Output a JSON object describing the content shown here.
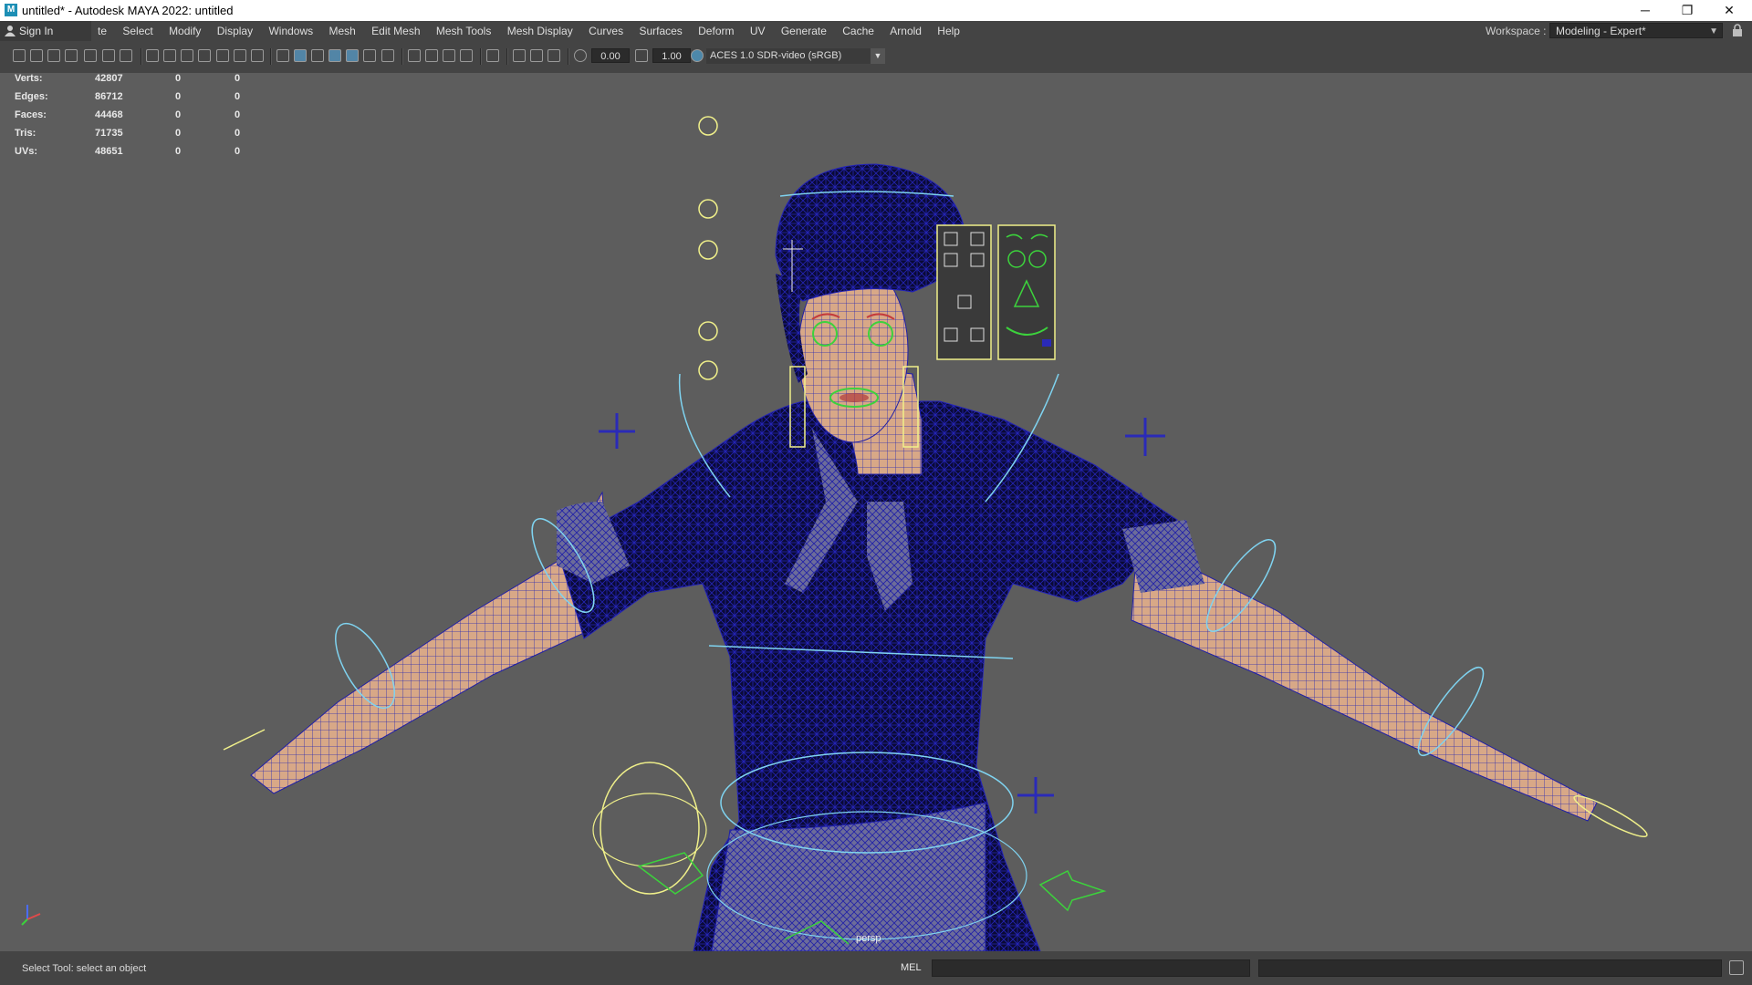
{
  "window": {
    "title": "untitled* - Autodesk MAYA 2022: untitled",
    "icon": "maya-logo-icon",
    "controls": {
      "minimize": "─",
      "restore": "❐",
      "close": "✕"
    }
  },
  "menubar": {
    "sign_in": "Sign In",
    "items": [
      "te",
      "Select",
      "Modify",
      "Display",
      "Windows",
      "Mesh",
      "Edit Mesh",
      "Mesh Tools",
      "Mesh Display",
      "Curves",
      "Surfaces",
      "Deform",
      "UV",
      "Generate",
      "Cache",
      "Arnold",
      "Help"
    ],
    "workspace_label": "Workspace :",
    "workspace_value": "Modeling - Expert*"
  },
  "toolbar": {
    "exposure_value": "0.00",
    "gamma_value": "1.00",
    "color_space": "ACES 1.0 SDR-video (sRGB)"
  },
  "hud": {
    "rows": [
      {
        "label": "Verts:",
        "v1": "42807",
        "v2": "0",
        "v3": "0"
      },
      {
        "label": "Edges:",
        "v1": "86712",
        "v2": "0",
        "v3": "0"
      },
      {
        "label": "Faces:",
        "v1": "44468",
        "v2": "0",
        "v3": "0"
      },
      {
        "label": "Tris:",
        "v1": "71735",
        "v2": "0",
        "v3": "0"
      },
      {
        "label": "UVs:",
        "v1": "48651",
        "v2": "0",
        "v3": "0"
      }
    ]
  },
  "viewport": {
    "camera_label": "persp",
    "colors": {
      "background": "#5d5d5d",
      "wire_blue": "#2222b8",
      "control_cyan": "#7fd3f0",
      "control_yellow": "#f0f08a",
      "control_green": "#3cd23c",
      "skin": "#d8a887",
      "dress": "#0a0a35"
    }
  },
  "status": {
    "help_line": "Select Tool: select an object",
    "script_type": "MEL"
  }
}
